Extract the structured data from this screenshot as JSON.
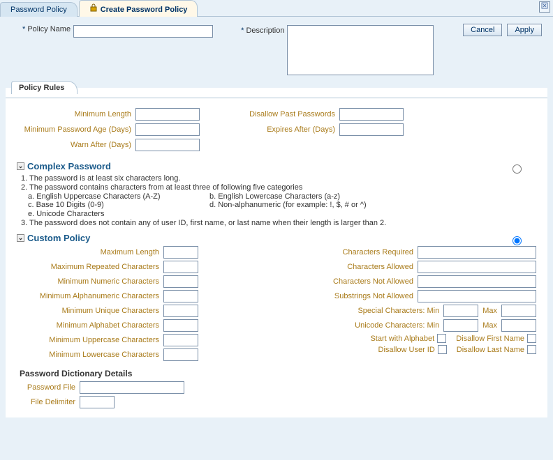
{
  "tabs": {
    "back": "Password Policy",
    "active": "Create Password Policy"
  },
  "header": {
    "policy_name_label": "Policy Name",
    "description_label": "Description",
    "cancel": "Cancel",
    "apply": "Apply"
  },
  "policy_rules": {
    "title": "Policy Rules",
    "left": {
      "min_length": "Minimum Length",
      "min_age": "Minimum Password Age (Days)",
      "warn_after": "Warn After (Days)"
    },
    "right": {
      "disallow_past": "Disallow Past Passwords",
      "expires_after": "Expires After (Days)"
    }
  },
  "complex": {
    "title": "Complex Password",
    "r1": "1. The password is at least six characters long.",
    "r2": "2. The password contains characters from at least three of following five categories",
    "r2a": "a. English Uppercase Characters (A-Z)",
    "r2b": "b. English Lowercase Characters (a-z)",
    "r2c": "c. Base 10 Digits (0-9)",
    "r2d": "d. Non-alphanumeric (for example: !, $, # or ^)",
    "r2e": "e. Unicode Characters",
    "r3": "3. The password does not contain any of user ID, first name, or last name when their length is larger than 2."
  },
  "custom": {
    "title": "Custom Policy",
    "left": {
      "max_length": "Maximum Length",
      "max_repeated": "Maximum Repeated Characters",
      "min_numeric": "Minimum Numeric Characters",
      "min_alnum": "Minimum Alphanumeric Characters",
      "min_unique": "Minimum Unique Characters",
      "min_alpha": "Minimum Alphabet Characters",
      "min_upper": "Minimum Uppercase Characters",
      "min_lower": "Minimum Lowercase Characters"
    },
    "right": {
      "chars_required": "Characters Required",
      "chars_allowed": "Characters Allowed",
      "chars_not_allowed": "Characters Not Allowed",
      "subs_not_allowed": "Substrings Not Allowed",
      "special_min": "Special Characters: Min",
      "unicode_min": "Unicode Characters: Min",
      "max_lbl": "Max",
      "start_alphabet": "Start with Alphabet",
      "disallow_first": "Disallow First Name",
      "disallow_user": "Disallow User ID",
      "disallow_last": "Disallow Last Name"
    }
  },
  "dict": {
    "title": "Password Dictionary Details",
    "file": "Password File",
    "delim": "File Delimiter"
  }
}
